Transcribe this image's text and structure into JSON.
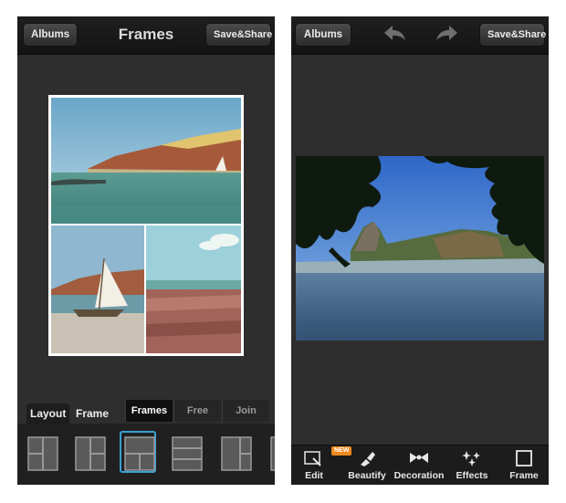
{
  "left_screen": {
    "albums_label": "Albums",
    "title": "Frames",
    "save_label": "Save&Share",
    "tabs": {
      "layout": "Layout",
      "frame": "Frame"
    },
    "segments": {
      "frames": "Frames",
      "free": "Free",
      "join": "Join",
      "selected": "Frames"
    },
    "layout_options": [
      "two-column",
      "two-column-alt",
      "top-wide-bottom-split",
      "three-rows",
      "two-column-narrow-right"
    ],
    "selected_layout": "top-wide-bottom-split"
  },
  "right_screen": {
    "albums_label": "Albums",
    "save_label": "Save&Share",
    "tools": [
      {
        "label": "Edit",
        "icon": "edit-icon",
        "badge": "NEW"
      },
      {
        "label": "Beautify",
        "icon": "lipstick-icon"
      },
      {
        "label": "Decoration",
        "icon": "bow-icon"
      },
      {
        "label": "Effects",
        "icon": "sparkle-icon"
      },
      {
        "label": "Frame",
        "icon": "frame-icon"
      }
    ]
  },
  "colors": {
    "accent": "#3aa0d4",
    "badge": "#f08a1d",
    "background": "#2e2e2e"
  }
}
